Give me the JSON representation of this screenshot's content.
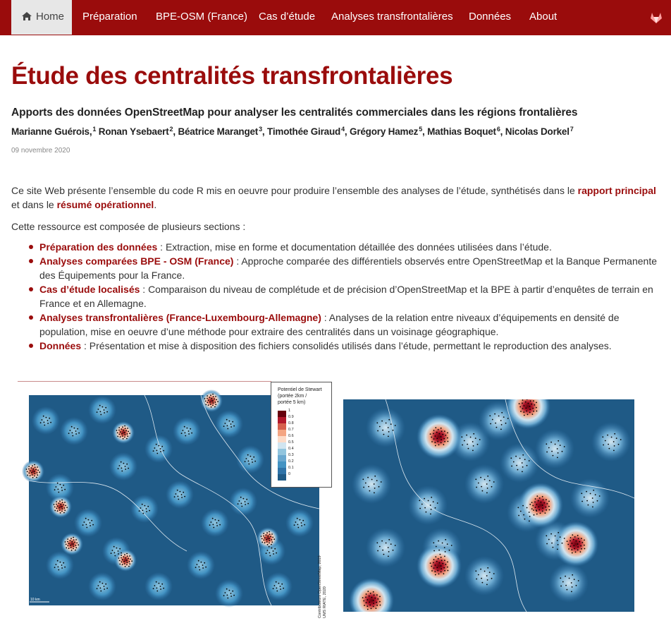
{
  "nav": {
    "home": "Home",
    "items": [
      "Préparation",
      "BPE-OSM (France)",
      "Cas d’étude",
      "Analyses transfrontalières",
      "Données",
      "About"
    ]
  },
  "icons": {
    "home": "home-icon",
    "gitlab": "gitlab-icon"
  },
  "colors": {
    "brand": "#9a0c0c",
    "map_sea": "#1f5a86"
  },
  "header": {
    "title": "Étude des centralités transfrontalières",
    "subtitle": "Apports des données OpenStreetMap pour analyser les centralités commerciales dans les régions frontalières",
    "authors": [
      {
        "name": "Marianne Guérois,",
        "sup": "1"
      },
      {
        "name": "Ronan Ysebaert",
        "sup": "2"
      },
      {
        "name": "Béatrice Maranget",
        "sup": "3"
      },
      {
        "name": "Timothée Giraud",
        "sup": "4"
      },
      {
        "name": "Grégory Hamez",
        "sup": "5"
      },
      {
        "name": "Mathias Boquet",
        "sup": "6"
      },
      {
        "name": "Nicolas Dorkel",
        "sup": "7"
      }
    ],
    "date": "09 novembre 2020"
  },
  "intro": {
    "before": "Ce site Web présente l’ensemble du code R mis en oeuvre pour produire l’ensemble des analyses de l’étude, synthétisés dans le ",
    "link1": "rapport principal",
    "middle": " et dans le ",
    "link2": "résumé opérationnel",
    "after": "."
  },
  "sections_intro": "Cette ressource est composée de plusieurs sections :",
  "sections": [
    {
      "link": "Préparation des données",
      "text": " : Extraction, mise en forme et documentation détaillée des données utilisées dans l’étude."
    },
    {
      "link": "Analyses comparées BPE - OSM (France)",
      "text": " : Approche comparée des différentiels observés entre OpenStreetMap et la Banque Permanente des Équipements pour la France."
    },
    {
      "link": "Cas d’étude localisés",
      "text": " : Comparaison du niveau de complétude et de précision d’OpenStreetMap et la BPE à partir d’enquêtes de terrain en France et en Allemagne."
    },
    {
      "link": "Analyses transfrontalières (France-Luxembourg-Allemagne)",
      "text": " : Analyses de la relation entre niveaux d’équipements en densité de population, mise en oeuvre d’une méthode pour extraire des centralités dans un voisinage géographique."
    },
    {
      "link": "Données",
      "text": " : Présentation et mise à disposition des fichiers consolidés utilisés dans l’étude, permettant le reproduction des analyses."
    }
  ],
  "legend": {
    "title_lines": [
      "Potentiel de Stewart",
      "(portée 2km /",
      "portée 5 km)"
    ],
    "labels": [
      "1",
      "0.9",
      "0.8",
      "0.7",
      "0.6",
      "0.5",
      "0.4",
      "0.3",
      "0.2",
      "0.1",
      "0"
    ],
    "colors": [
      "#67000d",
      "#b2182b",
      "#d6604d",
      "#f4a582",
      "#fddbc7",
      "#d1e5f0",
      "#92c5de",
      "#6aa8cf",
      "#4393c3",
      "#2f73a8",
      "#1f5a86"
    ]
  },
  "credit_lines": [
    "Contributeurs OpenStreetMap, 2019",
    "UMS RIATE, 2020"
  ],
  "scale_label": "10 km"
}
